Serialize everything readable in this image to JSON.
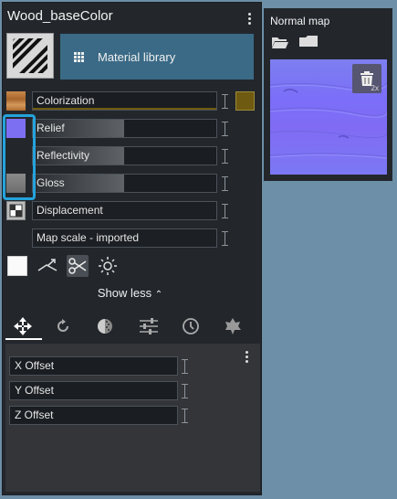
{
  "panel": {
    "title": "Wood_baseColor",
    "material_library_label": "Material library"
  },
  "channels": [
    {
      "label": "Colorization"
    },
    {
      "label": "Relief"
    },
    {
      "label": "Reflectivity"
    },
    {
      "label": "Gloss"
    },
    {
      "label": "Displacement"
    },
    {
      "label": "Map scale - imported"
    }
  ],
  "colors": {
    "accent": "#24a3dc",
    "library_button": "#3a6a86",
    "colorization_swatch": "#6e5a10",
    "relief_swatch": "#7d6ff2"
  },
  "show_less_label": "Show less",
  "tabs": [
    "move-icon",
    "rotate-icon",
    "contrast-icon",
    "sliders-icon",
    "clock-icon",
    "leaf-icon"
  ],
  "offsets": [
    {
      "label": "X Offset"
    },
    {
      "label": "Y Offset"
    },
    {
      "label": "Z Offset"
    }
  ],
  "normal_map": {
    "title": "Normal map",
    "delete_badge": "2x"
  }
}
